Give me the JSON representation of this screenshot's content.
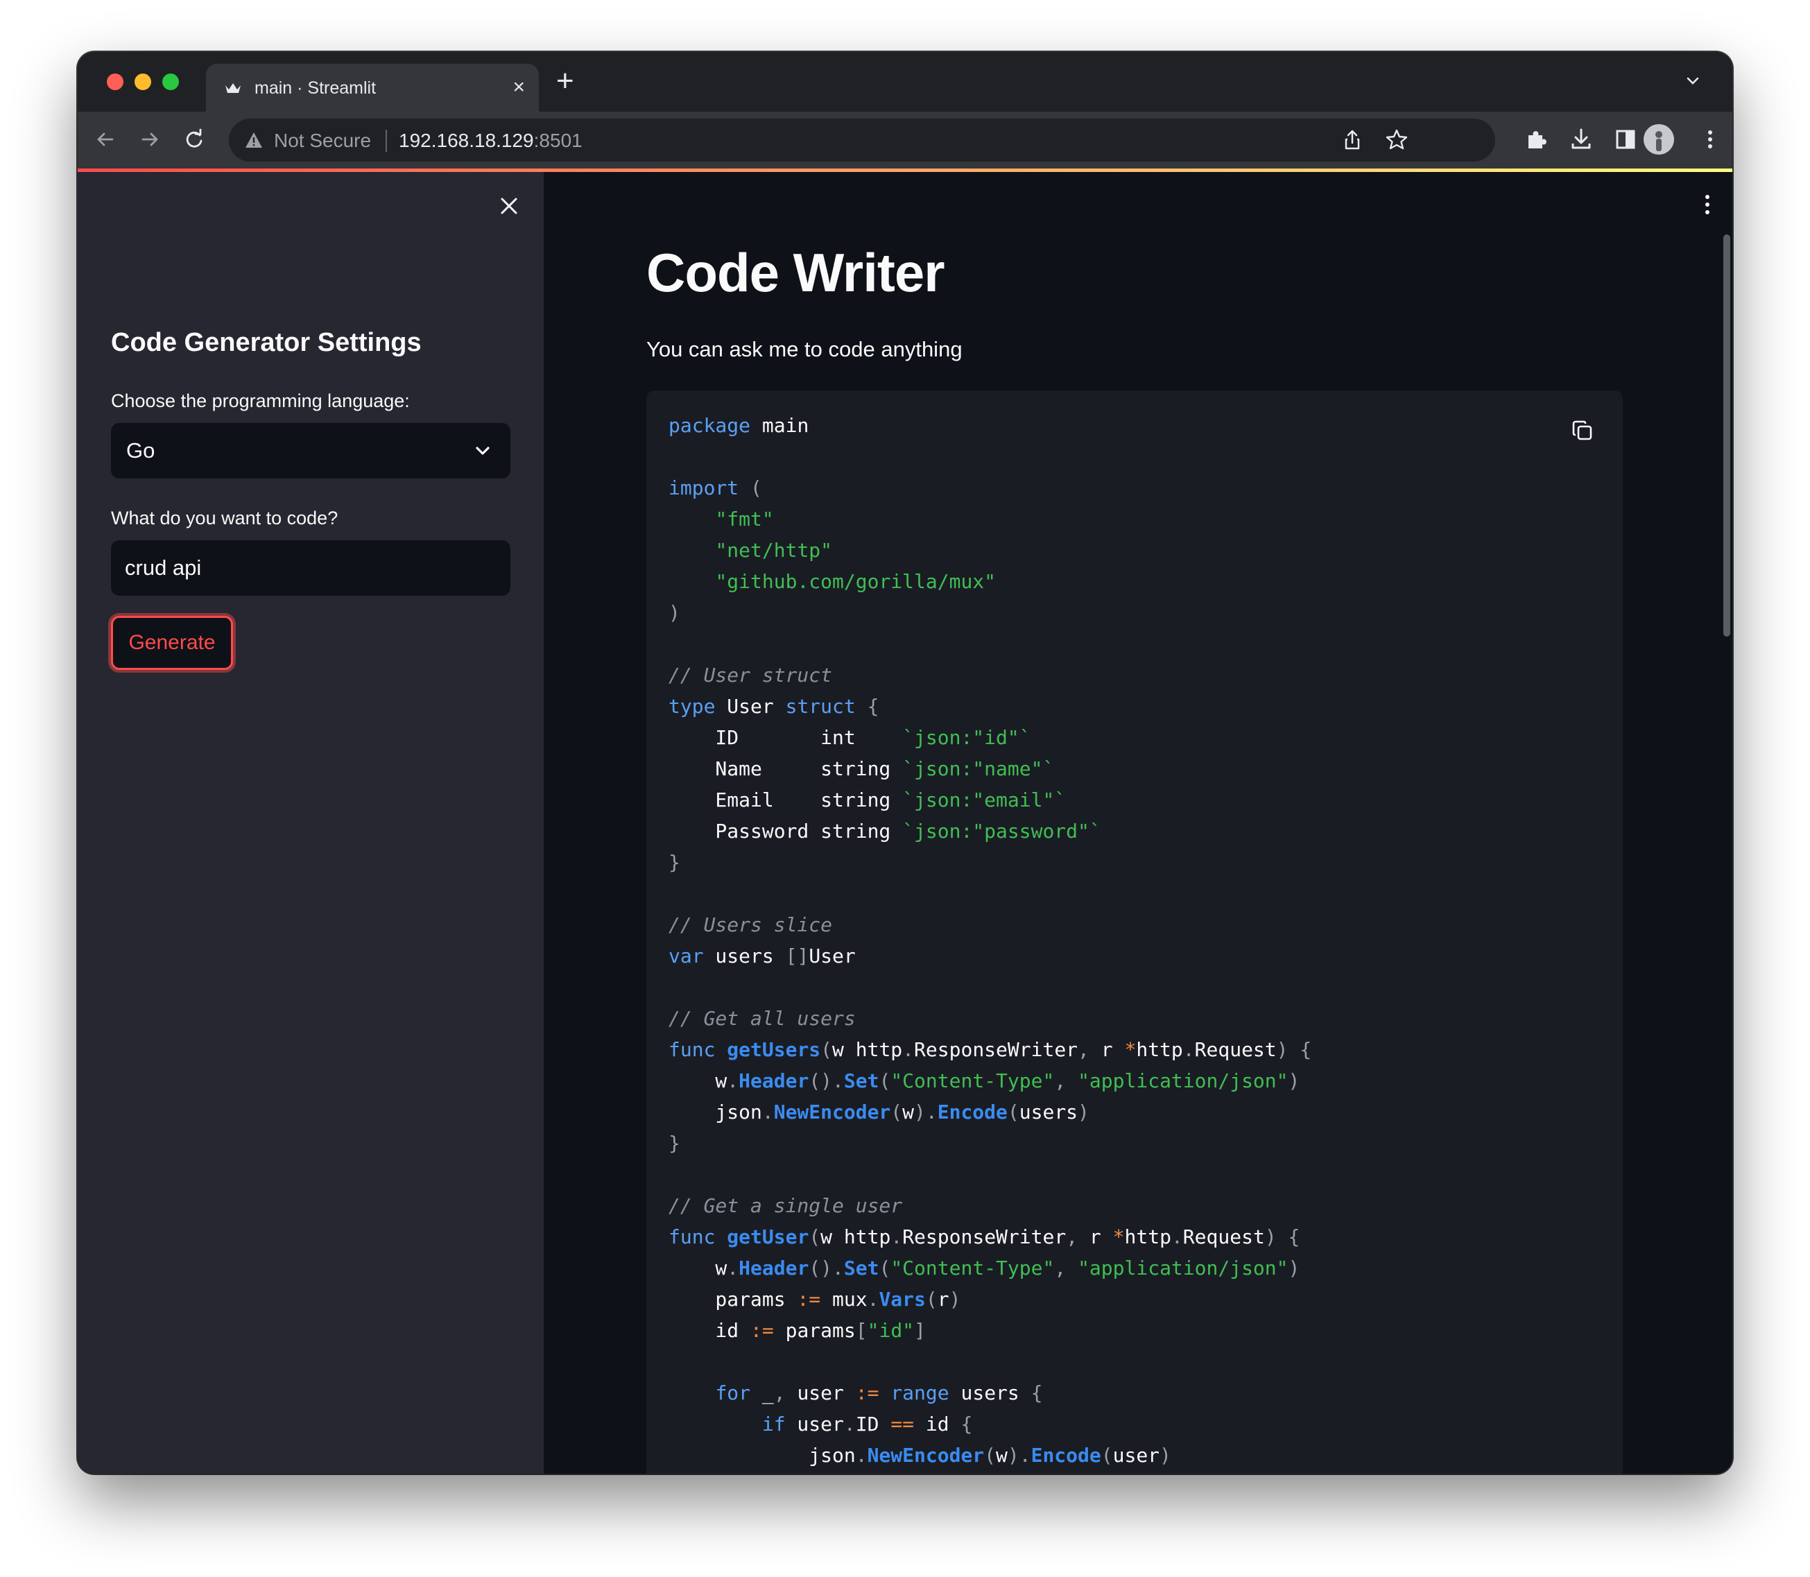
{
  "browser": {
    "tab_title": "main · Streamlit",
    "new_tab_symbol": "+",
    "close_symbol": "×",
    "security_label": "Not Secure",
    "url_host": "192.168.18.129",
    "url_port": ":8501"
  },
  "sidebar": {
    "heading": "Code Generator Settings",
    "language_label": "Choose the programming language:",
    "language_value": "Go",
    "prompt_label": "What do you want to code?",
    "prompt_value": "crud api",
    "generate_label": "Generate"
  },
  "main": {
    "title": "Code Writer",
    "caption": "You can ask me to code anything"
  },
  "colors": {
    "keyword": "#5aa0f2",
    "string": "#3fbf52",
    "comment": "#8b8f98",
    "function": "#3a8cf0",
    "operator": "#f08a3c",
    "punct": "#9aa0a6",
    "plain": "#fafafa",
    "accent": "#ff4b4b"
  },
  "code": [
    [
      [
        "kw",
        "package"
      ],
      [
        "p",
        " main"
      ]
    ],
    [],
    [
      [
        "kw",
        "import"
      ],
      [
        "pu",
        " ("
      ]
    ],
    [
      [
        "p",
        "    "
      ],
      [
        "s",
        "\"fmt\""
      ]
    ],
    [
      [
        "p",
        "    "
      ],
      [
        "s",
        "\"net/http\""
      ]
    ],
    [
      [
        "p",
        "    "
      ],
      [
        "s",
        "\"github.com/gorilla/mux\""
      ]
    ],
    [
      [
        "pu",
        ")"
      ]
    ],
    [],
    [
      [
        "c",
        "// User struct"
      ]
    ],
    [
      [
        "kw",
        "type"
      ],
      [
        "p",
        " User "
      ],
      [
        "kw",
        "struct"
      ],
      [
        "pu",
        " {"
      ]
    ],
    [
      [
        "p",
        "    ID       int    "
      ],
      [
        "s",
        "`json:\"id\"`"
      ]
    ],
    [
      [
        "p",
        "    Name     string "
      ],
      [
        "s",
        "`json:\"name\"`"
      ]
    ],
    [
      [
        "p",
        "    Email    string "
      ],
      [
        "s",
        "`json:\"email\"`"
      ]
    ],
    [
      [
        "p",
        "    Password string "
      ],
      [
        "s",
        "`json:\"password\"`"
      ]
    ],
    [
      [
        "pu",
        "}"
      ]
    ],
    [],
    [
      [
        "c",
        "// Users slice"
      ]
    ],
    [
      [
        "kw",
        "var"
      ],
      [
        "p",
        " users "
      ],
      [
        "pu",
        "[]"
      ],
      [
        "p",
        "User"
      ]
    ],
    [],
    [
      [
        "c",
        "// Get all users"
      ]
    ],
    [
      [
        "kw",
        "func"
      ],
      [
        "p",
        " "
      ],
      [
        "fn",
        "getUsers"
      ],
      [
        "pu",
        "("
      ],
      [
        "p",
        "w http"
      ],
      [
        "pu",
        "."
      ],
      [
        "p",
        "ResponseWriter"
      ],
      [
        "pu",
        ","
      ],
      [
        "p",
        " r "
      ],
      [
        "op",
        "*"
      ],
      [
        "p",
        "http"
      ],
      [
        "pu",
        "."
      ],
      [
        "p",
        "Request"
      ],
      [
        "pu",
        ") {"
      ]
    ],
    [
      [
        "p",
        "    w"
      ],
      [
        "pu",
        "."
      ],
      [
        "fn",
        "Header"
      ],
      [
        "pu",
        "()."
      ],
      [
        "fn",
        "Set"
      ],
      [
        "pu",
        "("
      ],
      [
        "s",
        "\"Content-Type\""
      ],
      [
        "pu",
        ", "
      ],
      [
        "s",
        "\"application/json\""
      ],
      [
        "pu",
        ")"
      ]
    ],
    [
      [
        "p",
        "    json"
      ],
      [
        "pu",
        "."
      ],
      [
        "fn",
        "NewEncoder"
      ],
      [
        "pu",
        "("
      ],
      [
        "p",
        "w"
      ],
      [
        "pu",
        ")."
      ],
      [
        "fn",
        "Encode"
      ],
      [
        "pu",
        "("
      ],
      [
        "p",
        "users"
      ],
      [
        "pu",
        ")"
      ]
    ],
    [
      [
        "pu",
        "}"
      ]
    ],
    [],
    [
      [
        "c",
        "// Get a single user"
      ]
    ],
    [
      [
        "kw",
        "func"
      ],
      [
        "p",
        " "
      ],
      [
        "fn",
        "getUser"
      ],
      [
        "pu",
        "("
      ],
      [
        "p",
        "w http"
      ],
      [
        "pu",
        "."
      ],
      [
        "p",
        "ResponseWriter"
      ],
      [
        "pu",
        ","
      ],
      [
        "p",
        " r "
      ],
      [
        "op",
        "*"
      ],
      [
        "p",
        "http"
      ],
      [
        "pu",
        "."
      ],
      [
        "p",
        "Request"
      ],
      [
        "pu",
        ") {"
      ]
    ],
    [
      [
        "p",
        "    w"
      ],
      [
        "pu",
        "."
      ],
      [
        "fn",
        "Header"
      ],
      [
        "pu",
        "()."
      ],
      [
        "fn",
        "Set"
      ],
      [
        "pu",
        "("
      ],
      [
        "s",
        "\"Content-Type\""
      ],
      [
        "pu",
        ", "
      ],
      [
        "s",
        "\"application/json\""
      ],
      [
        "pu",
        ")"
      ]
    ],
    [
      [
        "p",
        "    params "
      ],
      [
        "op",
        ":="
      ],
      [
        "p",
        " mux"
      ],
      [
        "pu",
        "."
      ],
      [
        "fn",
        "Vars"
      ],
      [
        "pu",
        "("
      ],
      [
        "p",
        "r"
      ],
      [
        "pu",
        ")"
      ]
    ],
    [
      [
        "p",
        "    id "
      ],
      [
        "op",
        ":="
      ],
      [
        "p",
        " params"
      ],
      [
        "pu",
        "["
      ],
      [
        "s",
        "\"id\""
      ],
      [
        "pu",
        "]"
      ]
    ],
    [],
    [
      [
        "p",
        "    "
      ],
      [
        "kw",
        "for"
      ],
      [
        "p",
        " _"
      ],
      [
        "pu",
        ","
      ],
      [
        "p",
        " user "
      ],
      [
        "op",
        ":="
      ],
      [
        "p",
        " "
      ],
      [
        "kw",
        "range"
      ],
      [
        "p",
        " users "
      ],
      [
        "pu",
        "{"
      ]
    ],
    [
      [
        "p",
        "        "
      ],
      [
        "kw",
        "if"
      ],
      [
        "p",
        " user"
      ],
      [
        "pu",
        "."
      ],
      [
        "p",
        "ID "
      ],
      [
        "op",
        "=="
      ],
      [
        "p",
        " id "
      ],
      [
        "pu",
        "{"
      ]
    ],
    [
      [
        "p",
        "            json"
      ],
      [
        "pu",
        "."
      ],
      [
        "fn",
        "NewEncoder"
      ],
      [
        "pu",
        "("
      ],
      [
        "p",
        "w"
      ],
      [
        "pu",
        ")."
      ],
      [
        "fn",
        "Encode"
      ],
      [
        "pu",
        "("
      ],
      [
        "p",
        "user"
      ],
      [
        "pu",
        ")"
      ]
    ]
  ]
}
